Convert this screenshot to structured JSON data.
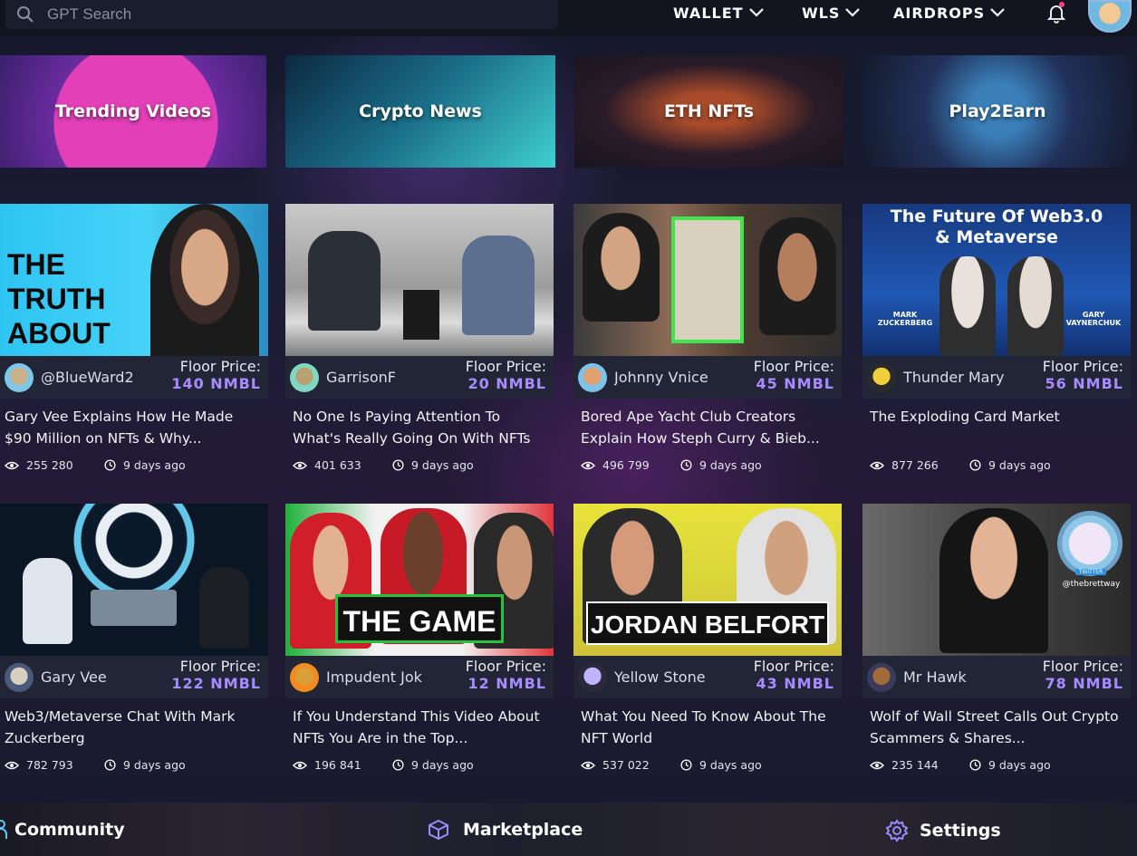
{
  "search": {
    "placeholder": "GPT Search"
  },
  "nav": [
    {
      "label": "WALLET"
    },
    {
      "label": "WLS"
    },
    {
      "label": "AIRDROPS"
    }
  ],
  "categories": [
    {
      "label": "Trending Videos"
    },
    {
      "label": "Crypto News"
    },
    {
      "label": "ETH NFTs"
    },
    {
      "label": "Play2Earn"
    }
  ],
  "floor_label": "Floor Price:",
  "videos": [
    {
      "thumb_text": "THE TRUTH ABOUT NFTs",
      "user": "@BlueWard2",
      "floor": "140 NMBL",
      "title": "Gary Vee Explains How He Made $90 Million on NFTs & Why...",
      "views": "255 280",
      "time": "9 days ago"
    },
    {
      "thumb_text": "",
      "user": "GarrisonF",
      "floor": "20 NMBL",
      "title": "No One Is Paying Attention To What's Really Going On With NFTs",
      "views": "401 633",
      "time": "9 days ago"
    },
    {
      "thumb_text": "",
      "user": "Johnny Vnice",
      "floor": "45 NMBL",
      "title": "Bored Ape Yacht Club Creators Explain How Steph Curry & Bieb...",
      "views": "496 799",
      "time": "9 days ago"
    },
    {
      "thumb_text": "The Future Of Web3.0 & Metaverse",
      "thumb_sub_left": "MARK ZUCKERBERG",
      "thumb_sub_right": "GARY VAYNERCHUK",
      "user": "Thunder Mary",
      "floor": "56 NMBL",
      "title": "The Exploding Card Market",
      "views": "877 266",
      "time": "9 days ago"
    },
    {
      "thumb_text": "",
      "user": "Gary Vee",
      "floor": "122 NMBL",
      "title": "Web3/Metaverse Chat With Mark Zuckerberg",
      "views": "782 793",
      "time": "9 days ago"
    },
    {
      "thumb_text": "THE GAME",
      "user": "Impudent Jok",
      "floor": "12 NMBL",
      "title": "If You Understand This Video About NFTs You Are in the Top...",
      "views": "196 841",
      "time": "9 days ago"
    },
    {
      "thumb_text": "JORDAN BELFORT",
      "user": "Yellow Stone",
      "floor": "43 NMBL",
      "title": "What You Need To Know About The NFT World",
      "views": "537 022",
      "time": "9 days ago"
    },
    {
      "thumb_text": "",
      "thumb_badge": "TWITTER",
      "thumb_handle": "@thebrettway",
      "user": "Mr Hawk",
      "floor": "78 NMBL",
      "title": "Wolf of Wall Street Calls Out Crypto Scammers & Shares...",
      "views": "235 144",
      "time": "9 days ago"
    }
  ],
  "bottom_nav": [
    {
      "label": "Community",
      "icon": "community-icon"
    },
    {
      "label": "Marketplace",
      "icon": "cube-icon"
    },
    {
      "label": "Settings",
      "icon": "gear-icon"
    }
  ],
  "colors": {
    "accent": "#a78cff",
    "bg": "#1d1c35",
    "card_bar": "#222536"
  }
}
